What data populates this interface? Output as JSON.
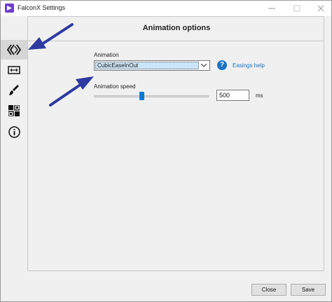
{
  "window": {
    "title": "FalconX Settings",
    "controls": [
      "minimize-icon",
      "maximize-icon",
      "close-icon"
    ]
  },
  "sidebar": {
    "items": [
      {
        "icon": "falconx-logo-icon",
        "active": true
      },
      {
        "icon": "width-icon",
        "active": false
      },
      {
        "icon": "brush-icon",
        "active": false
      },
      {
        "icon": "grid-icon",
        "active": false
      },
      {
        "icon": "info-icon",
        "active": false
      }
    ]
  },
  "main": {
    "title": "Animation options",
    "animation": {
      "label": "Animation",
      "selected": "CubicEaseInOut",
      "help_link": "Easings help"
    },
    "speed": {
      "label": "Animation speed",
      "value": "500",
      "unit": "ms",
      "slider_fraction": 0.42
    }
  },
  "footer": {
    "close_label": "Close",
    "save_label": "Save"
  },
  "colors": {
    "accent": "#0078d7",
    "link": "#1a73c2",
    "annotation_arrow": "#2e3a9e"
  }
}
